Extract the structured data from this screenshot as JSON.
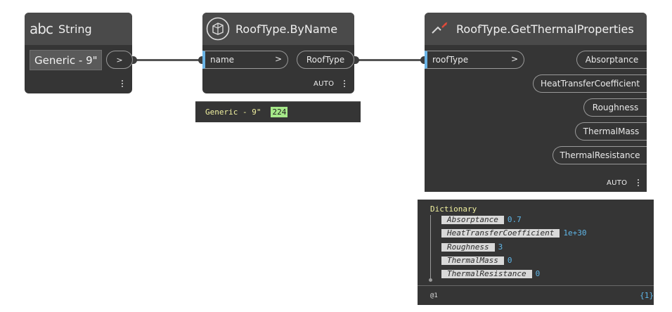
{
  "string_node": {
    "icon_text": "abc",
    "title": "String",
    "value": "Generic - 9\"",
    "out_port": ">"
  },
  "byname_node": {
    "title": "RoofType.ByName",
    "input_label": "name",
    "input_chevron": ">",
    "output_label": "RoofType",
    "lacing": "AUTO",
    "preview": {
      "text": "Generic - 9\"",
      "id_badge": "224"
    }
  },
  "thermal_node": {
    "title": "RoofType.GetThermalProperties",
    "input_label": "roofType",
    "input_chevron": ">",
    "outputs": [
      "Absorptance",
      "HeatTransferCoefficient",
      "Roughness",
      "ThermalMass",
      "ThermalResistance"
    ],
    "lacing": "AUTO",
    "preview": {
      "type": "Dictionary",
      "entries": [
        {
          "key": "Absorptance",
          "value": "0.7"
        },
        {
          "key": "HeatTransferCoefficient",
          "value": "1e+30"
        },
        {
          "key": "Roughness",
          "value": "3"
        },
        {
          "key": "ThermalMass",
          "value": "0"
        },
        {
          "key": "ThermalResistance",
          "value": "0"
        }
      ],
      "level": "@1",
      "count": "{1}"
    }
  },
  "colors": {
    "node_body": "#353535",
    "node_header": "#4a4a4a",
    "input_port_marker": "#6ab4e6",
    "id_badge": "#a6e889",
    "dictionary_title": "#f2f2a0",
    "dictionary_value": "#5fb6e8"
  }
}
